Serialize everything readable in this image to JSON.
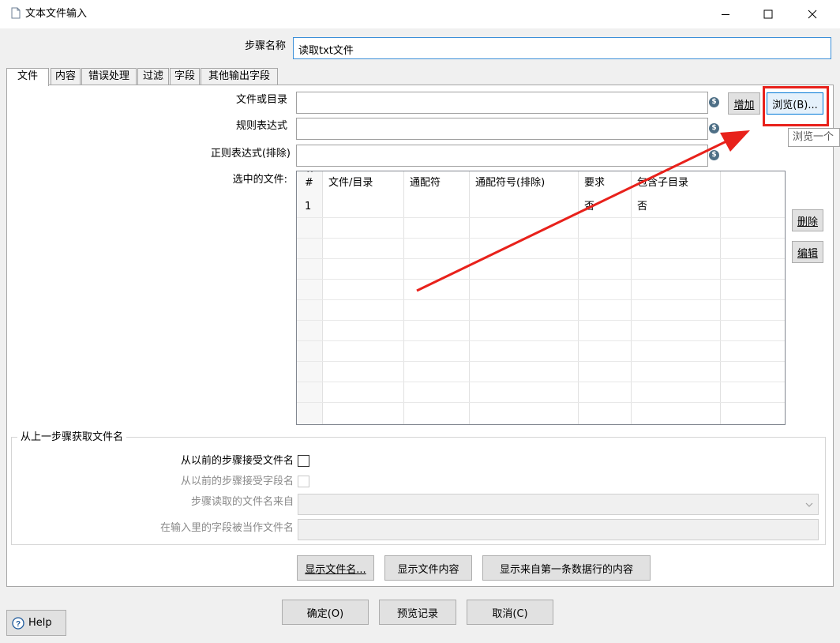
{
  "window": {
    "title": "文本文件输入",
    "icon": "document-icon",
    "controls": [
      "minimize-icon",
      "maximize-icon",
      "close-icon"
    ]
  },
  "step_name": {
    "label": "步骤名称",
    "value": "读取txt文件"
  },
  "tabs": [
    {
      "label": "文件",
      "active": true
    },
    {
      "label": "内容"
    },
    {
      "label": "错误处理"
    },
    {
      "label": "过滤"
    },
    {
      "label": "字段"
    },
    {
      "label": "其他输出字段"
    }
  ],
  "file_tab": {
    "file_or_dir_label": "文件或目录",
    "regex_label": "规则表达式",
    "regex_exclude_label": "正则表达式(排除)",
    "selected_files_label": "选中的文件:",
    "add_button": "增加",
    "browse_button": "浏览(B)...",
    "browse_tooltip": "浏览一个",
    "delete_button": "删除",
    "edit_button": "编辑",
    "table": {
      "sort_indicator": "^",
      "columns": [
        "#",
        "文件/目录",
        "通配符",
        "通配符号(排除)",
        "要求",
        "包含子目录"
      ],
      "rows": [
        {
          "num": "1",
          "file": "",
          "wildcard": "",
          "wildcard_exclude": "",
          "required": "否",
          "subdirs": "否"
        }
      ]
    }
  },
  "prev_step_group": {
    "title": "从上一步骤获取文件名",
    "accept_filenames_label": "从以前的步骤接受文件名",
    "accept_fields_label": "从以前的步骤接受字段名",
    "source_step_label": "步骤读取的文件名来自",
    "field_as_filename_label": "在输入里的字段被当作文件名"
  },
  "bottom_buttons": {
    "show_filenames": "显示文件名...",
    "show_file_content": "显示文件内容",
    "show_first_row_content": "显示来自第一条数据行的内容"
  },
  "dialog_buttons": {
    "ok": "确定(O)",
    "preview": "预览记录",
    "cancel": "取消(C)",
    "help": "Help"
  },
  "annotation": {
    "highlight_color": "#e8211b",
    "arrow_color": "#e8211b"
  }
}
